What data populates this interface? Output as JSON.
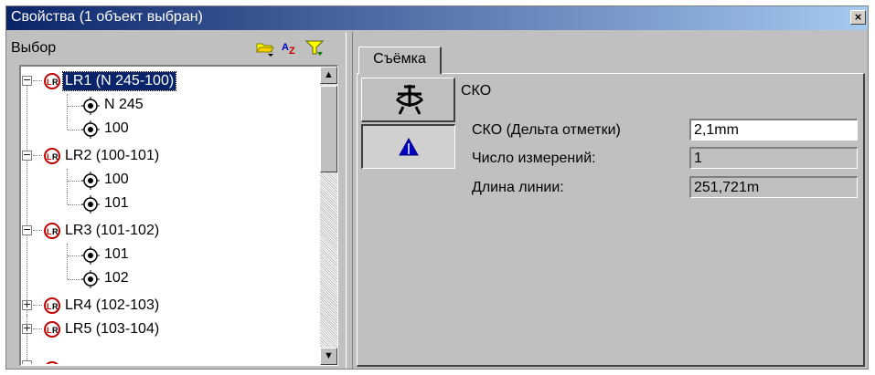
{
  "window": {
    "title": "Свойства (1 объект выбран)",
    "close_glyph": "×"
  },
  "left_panel": {
    "header_label": "Выбор",
    "icons": [
      "folder-icon",
      "sort-az-icon",
      "filter-icon"
    ],
    "sort_glyph": "AZ"
  },
  "tree": {
    "expand_collapsed": "+",
    "expand_expanded": "−",
    "items": [
      {
        "label": "LR1 (N 245-100)",
        "expanded": true,
        "selected": true,
        "children": [
          "N 245",
          "100"
        ]
      },
      {
        "label": "LR2 (100-101)",
        "expanded": true,
        "selected": false,
        "children": [
          "100",
          "101"
        ]
      },
      {
        "label": "LR3 (101-102)",
        "expanded": true,
        "selected": false,
        "children": [
          "101",
          "102"
        ]
      },
      {
        "label": "LR4 (102-103)",
        "expanded": false,
        "selected": false,
        "children": []
      },
      {
        "label": "LR5 (103-104)",
        "expanded": false,
        "selected": false,
        "children": []
      }
    ]
  },
  "scrollbar": {
    "up_glyph": "▲",
    "down_glyph": "▼"
  },
  "right_panel": {
    "tab_label": "Съёмка",
    "section_title": "СКО",
    "fields": [
      {
        "label": "СКО (Дельта отметки)",
        "value": "2,1mm",
        "editable": true
      },
      {
        "label": "Число измерений:",
        "value": "1",
        "editable": false
      },
      {
        "label": "Длина линии:",
        "value": "251,721m",
        "editable": false
      }
    ]
  },
  "colors": {
    "title_gradient_start": "#0a246a",
    "title_gradient_end": "#a6caf0",
    "selection": "#0a246a",
    "dialog_face": "#c0c0c0",
    "accent_blue": "#0000c0"
  }
}
